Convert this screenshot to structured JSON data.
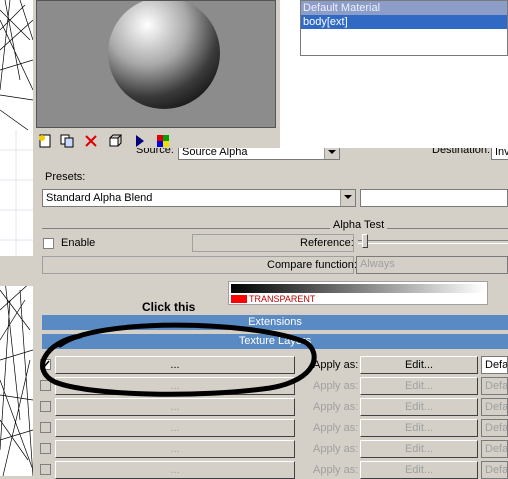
{
  "materials": {
    "items": [
      "Default Material",
      "body[ext]"
    ],
    "selected_index": 1
  },
  "source_row": {
    "source_label": "Source:",
    "source_value": "Source Alpha",
    "destination_label": "Destination:",
    "destination_value": "Inv"
  },
  "presets": {
    "label": "Presets:",
    "value": "Standard Alpha Blend"
  },
  "alpha_test": {
    "title": "Alpha Test",
    "enable_label": "Enable",
    "reference_label": "Reference:",
    "compare_label": "Compare function:",
    "compare_value": "Always"
  },
  "gradient": {
    "transparent_label": "TRANSPARENT"
  },
  "annotation": {
    "text": "Click this"
  },
  "extensions": {
    "title": "Extensions"
  },
  "texture_layers": {
    "title": "Texture Layers",
    "rows": [
      {
        "button": "...",
        "apply_label": "Apply as:",
        "edit_label": "Edit...",
        "mode": "Defa",
        "enabled": true
      },
      {
        "button": "...",
        "apply_label": "Apply as:",
        "edit_label": "Edit...",
        "mode": "Defa",
        "enabled": false
      },
      {
        "button": "...",
        "apply_label": "Apply as:",
        "edit_label": "Edit...",
        "mode": "Defa",
        "enabled": false
      },
      {
        "button": "...",
        "apply_label": "Apply as:",
        "edit_label": "Edit...",
        "mode": "Defa",
        "enabled": false
      },
      {
        "button": "...",
        "apply_label": "Apply as:",
        "edit_label": "Edit...",
        "mode": "Defa",
        "enabled": false
      },
      {
        "button": "...",
        "apply_label": "Apply as:",
        "edit_label": "Edit...",
        "mode": "Defa",
        "enabled": false
      }
    ]
  },
  "toolbar_icons": [
    "new-material-icon",
    "copy-material-icon",
    "delete-icon",
    "cube-icon",
    "play-icon",
    "color-palette-icon"
  ],
  "colors": {
    "accent": "#316ac5",
    "section_bar": "#5a8ac4",
    "annotation": "#000000",
    "transparent_swatch": "#ff0000"
  }
}
